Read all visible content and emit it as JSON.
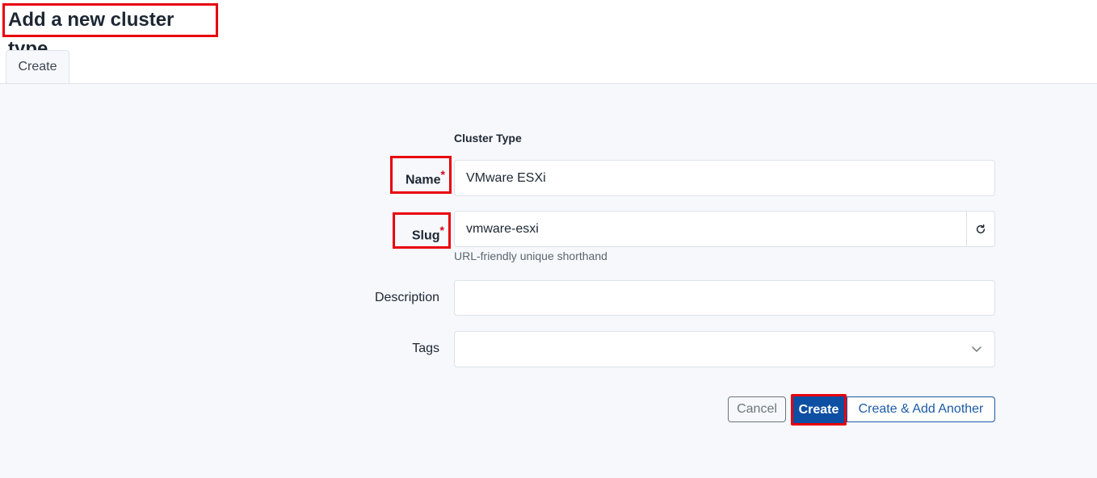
{
  "header": {
    "title": "Add a new cluster type"
  },
  "tabs": [
    {
      "label": "Create"
    }
  ],
  "form": {
    "section_title": "Cluster Type",
    "name": {
      "label": "Name",
      "required_mark": "*",
      "value": "VMware ESXi"
    },
    "slug": {
      "label": "Slug",
      "required_mark": "*",
      "value": "vmware-esxi",
      "help": "URL-friendly unique shorthand"
    },
    "description": {
      "label": "Description",
      "value": ""
    },
    "tags": {
      "label": "Tags",
      "value": ""
    }
  },
  "actions": {
    "cancel": "Cancel",
    "create": "Create",
    "create_another": "Create & Add Another"
  },
  "icons": {
    "slug_regenerate": "refresh-icon",
    "tags_dropdown": "chevron-down-icon"
  },
  "colors": {
    "primary": "#0d4fa3",
    "highlight": "#e8000b",
    "required": "#d6001c",
    "background": "#f6f8fb"
  }
}
